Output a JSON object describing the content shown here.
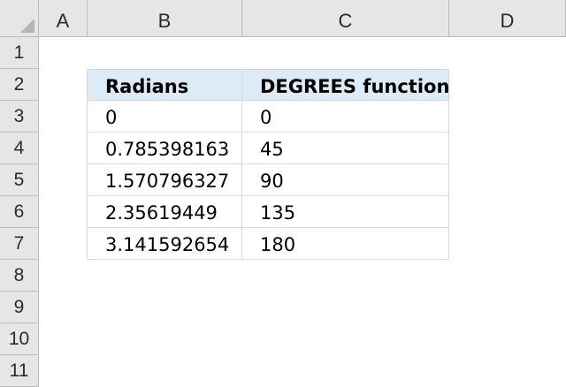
{
  "columns": [
    "A",
    "B",
    "C",
    "D"
  ],
  "rows": [
    "1",
    "2",
    "3",
    "4",
    "5",
    "6",
    "7",
    "8",
    "9",
    "10",
    "11"
  ],
  "table": {
    "headers": [
      "Radians",
      "DEGREES function"
    ],
    "data": [
      [
        "0",
        "0"
      ],
      [
        "0.785398163",
        "45"
      ],
      [
        "1.570796327",
        "90"
      ],
      [
        "2.35619449",
        "135"
      ],
      [
        "3.141592654",
        "180"
      ]
    ]
  },
  "colors": {
    "header_fill": "#ddebf7",
    "headers_bg": "#e6e6e6",
    "gridline": "#d9d9d9"
  }
}
